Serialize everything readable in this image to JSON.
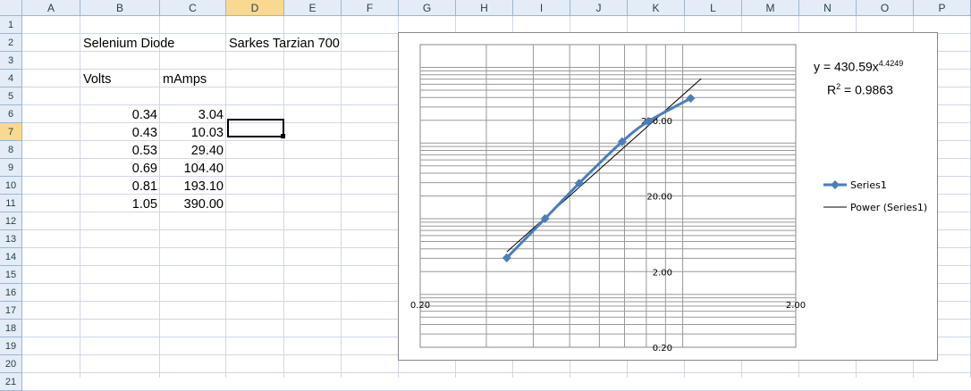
{
  "columns": [
    "A",
    "B",
    "C",
    "D",
    "E",
    "F",
    "G",
    "H",
    "I",
    "J",
    "K",
    "L",
    "M",
    "N",
    "O",
    "P"
  ],
  "rows": [
    "1",
    "2",
    "3",
    "4",
    "5",
    "6",
    "7",
    "8",
    "9",
    "10",
    "11",
    "12",
    "13",
    "14",
    "15",
    "16",
    "17",
    "18",
    "19",
    "20",
    "21"
  ],
  "active_cell": "D7",
  "cells": {
    "B2": "Selenium Diode",
    "D2": "Sarkes Tarzian 700",
    "B4": "Volts",
    "C4": "mAmps",
    "B6": "0.34",
    "C6": "3.04",
    "B7": "0.43",
    "C7": "10.03",
    "B8": "0.53",
    "C8": "29.40",
    "B9": "0.69",
    "C9": "104.40",
    "B10": "0.81",
    "C10": "193.10",
    "B11": "1.05",
    "C11": "390.00"
  },
  "chart_data": {
    "type": "scatter",
    "x_scale": "log",
    "y_scale": "log",
    "xlim": [
      0.2,
      2.0
    ],
    "ylim": [
      0.2,
      2000
    ],
    "x_tick_labels": [
      "0.20",
      "2.00"
    ],
    "y_tick_labels": [
      "0.20",
      "2.00",
      "20.00",
      "200.00"
    ],
    "grid": true,
    "legend_position": "right",
    "series": [
      {
        "name": "Series1",
        "color": "#4a7ebb",
        "x": [
          0.34,
          0.43,
          0.53,
          0.69,
          0.81,
          1.05
        ],
        "y": [
          3.04,
          10.03,
          29.4,
          104.4,
          193.1,
          390.0
        ]
      }
    ],
    "trendline": {
      "name": "Power (Series1)",
      "type": "power",
      "coefficient": 430.59,
      "exponent": 4.4249,
      "equation": "y = 430.59x",
      "exponent_label": "4.4249",
      "r_squared_prefix": "R",
      "r_squared_sup": "2",
      "r_squared_value": " = 0.9863",
      "color": "#000000"
    },
    "legend": [
      "Series1",
      "Power (Series1)"
    ]
  }
}
